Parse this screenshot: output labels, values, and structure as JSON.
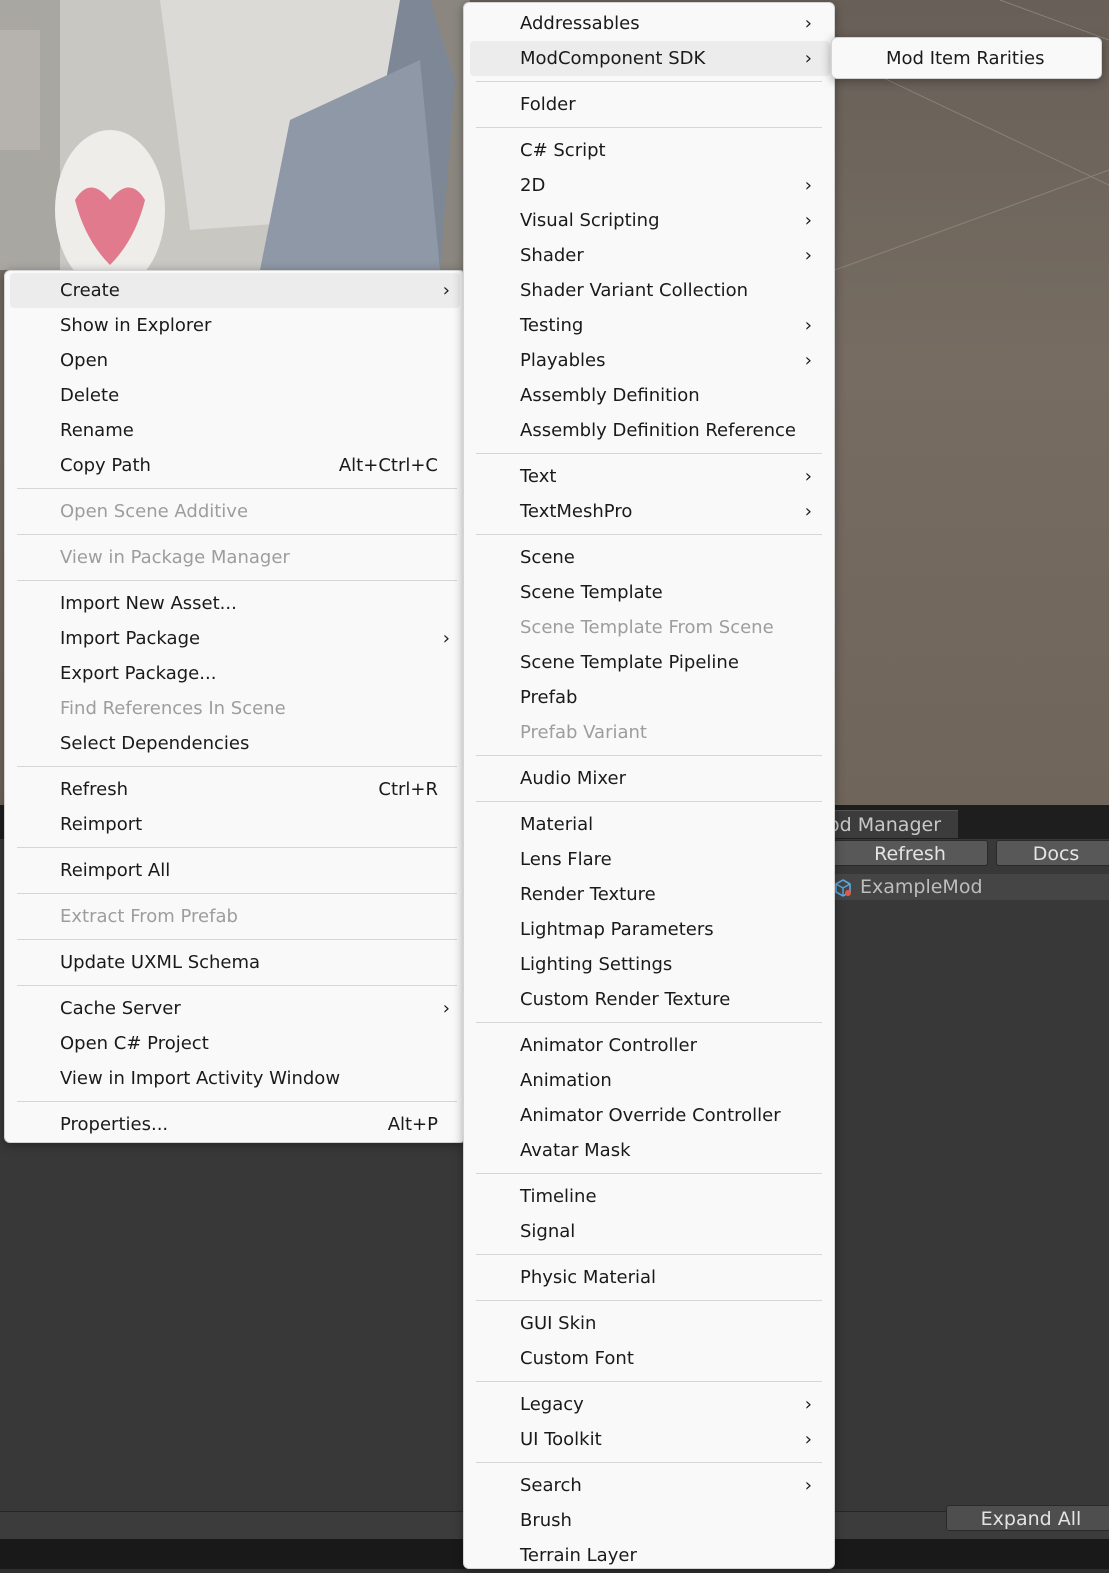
{
  "context_menu": {
    "items": [
      {
        "label": "Create",
        "submenu": true,
        "highlighted": true
      },
      {
        "label": "Show in Explorer"
      },
      {
        "label": "Open"
      },
      {
        "label": "Delete"
      },
      {
        "label": "Rename"
      },
      {
        "label": "Copy Path",
        "shortcut": "Alt+Ctrl+C"
      },
      {
        "separator": true
      },
      {
        "label": "Open Scene Additive",
        "disabled": true
      },
      {
        "separator": true
      },
      {
        "label": "View in Package Manager",
        "disabled": true
      },
      {
        "separator": true
      },
      {
        "label": "Import New Asset..."
      },
      {
        "label": "Import Package",
        "submenu": true
      },
      {
        "label": "Export Package..."
      },
      {
        "label": "Find References In Scene",
        "disabled": true
      },
      {
        "label": "Select Dependencies"
      },
      {
        "separator": true
      },
      {
        "label": "Refresh",
        "shortcut": "Ctrl+R"
      },
      {
        "label": "Reimport"
      },
      {
        "separator": true
      },
      {
        "label": "Reimport All"
      },
      {
        "separator": true
      },
      {
        "label": "Extract From Prefab",
        "disabled": true
      },
      {
        "separator": true
      },
      {
        "label": "Update UXML Schema"
      },
      {
        "separator": true
      },
      {
        "label": "Cache Server",
        "submenu": true
      },
      {
        "label": "Open C# Project"
      },
      {
        "label": "View in Import Activity Window"
      },
      {
        "separator": true
      },
      {
        "label": "Properties...",
        "shortcut": "Alt+P"
      }
    ]
  },
  "create_menu": {
    "items": [
      {
        "label": "Addressables",
        "submenu": true
      },
      {
        "label": "ModComponent SDK",
        "submenu": true,
        "highlighted": true
      },
      {
        "separator": true
      },
      {
        "label": "Folder"
      },
      {
        "separator": true
      },
      {
        "label": "C# Script"
      },
      {
        "label": "2D",
        "submenu": true
      },
      {
        "label": "Visual Scripting",
        "submenu": true
      },
      {
        "label": "Shader",
        "submenu": true
      },
      {
        "label": "Shader Variant Collection"
      },
      {
        "label": "Testing",
        "submenu": true
      },
      {
        "label": "Playables",
        "submenu": true
      },
      {
        "label": "Assembly Definition"
      },
      {
        "label": "Assembly Definition Reference"
      },
      {
        "separator": true
      },
      {
        "label": "Text",
        "submenu": true
      },
      {
        "label": "TextMeshPro",
        "submenu": true
      },
      {
        "separator": true
      },
      {
        "label": "Scene"
      },
      {
        "label": "Scene Template"
      },
      {
        "label": "Scene Template From Scene",
        "disabled": true
      },
      {
        "label": "Scene Template Pipeline"
      },
      {
        "label": "Prefab"
      },
      {
        "label": "Prefab Variant",
        "disabled": true
      },
      {
        "separator": true
      },
      {
        "label": "Audio Mixer"
      },
      {
        "separator": true
      },
      {
        "label": "Material"
      },
      {
        "label": "Lens Flare"
      },
      {
        "label": "Render Texture"
      },
      {
        "label": "Lightmap Parameters"
      },
      {
        "label": "Lighting Settings"
      },
      {
        "label": "Custom Render Texture"
      },
      {
        "separator": true
      },
      {
        "label": "Animator Controller"
      },
      {
        "label": "Animation"
      },
      {
        "label": "Animator Override Controller"
      },
      {
        "label": "Avatar Mask"
      },
      {
        "separator": true
      },
      {
        "label": "Timeline"
      },
      {
        "label": "Signal"
      },
      {
        "separator": true
      },
      {
        "label": "Physic Material"
      },
      {
        "separator": true
      },
      {
        "label": "GUI Skin"
      },
      {
        "label": "Custom Font"
      },
      {
        "separator": true
      },
      {
        "label": "Legacy",
        "submenu": true
      },
      {
        "label": "UI Toolkit",
        "submenu": true
      },
      {
        "separator": true
      },
      {
        "label": "Search",
        "submenu": true
      },
      {
        "label": "Brush"
      },
      {
        "label": "Terrain Layer"
      }
    ]
  },
  "modcomponent_menu": {
    "items": [
      {
        "label": "Mod Item Rarities"
      }
    ]
  },
  "mod_manager": {
    "tab_label": "od Manager",
    "refresh_label": "Refresh",
    "docs_label": "Docs",
    "tree_item": "ExampleMod",
    "expand_all_label": "Expand All"
  },
  "icons": {
    "submenu_arrow": "chevron-right-icon",
    "tree_item_icon": "prefab-package-icon"
  }
}
